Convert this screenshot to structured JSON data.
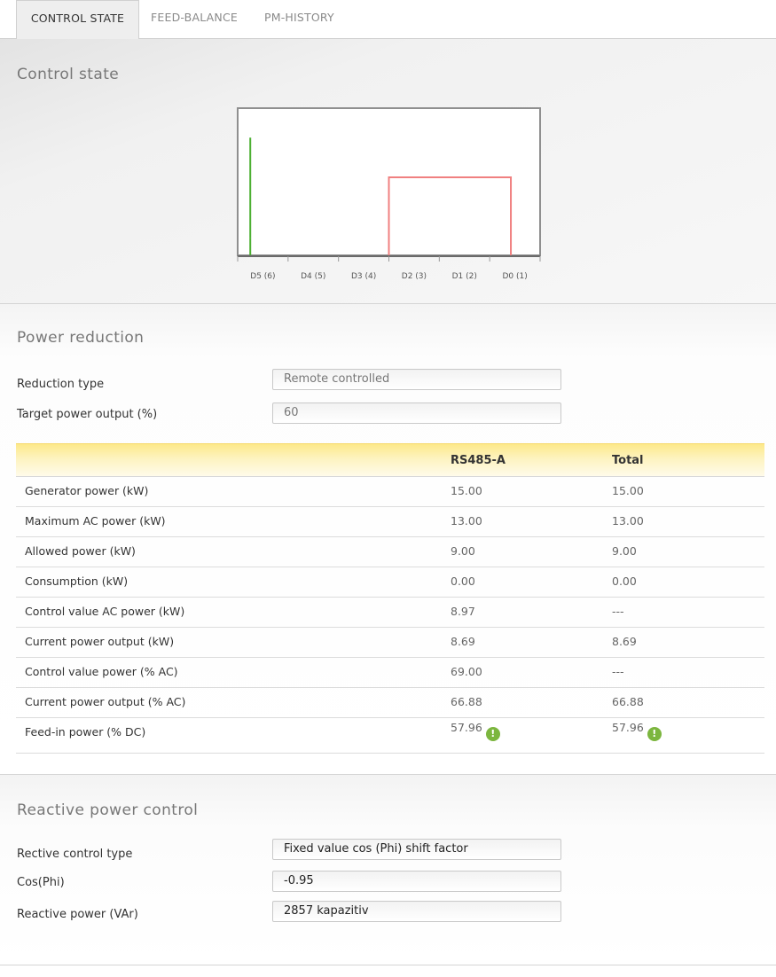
{
  "tabs": [
    {
      "label": "CONTROL STATE",
      "active": true
    },
    {
      "label": "FEED-BALANCE",
      "active": false
    },
    {
      "label": "PM-HISTORY",
      "active": false
    }
  ],
  "control_state": {
    "title": "Control state",
    "chart_data": {
      "type": "line",
      "categories": [
        "D5 (6)",
        "D4 (5)",
        "D3 (4)",
        "D2 (3)",
        "D1 (2)",
        "D0 (1)"
      ],
      "series": [
        {
          "color": "#4caf32",
          "segments": [
            {
              "x": 0.25,
              "level_start": 0.12,
              "level_end": 0.8
            }
          ]
        },
        {
          "color": "#f08080",
          "segments": [
            {
              "from": 3.0,
              "to": 5.0,
              "level": 0.53
            }
          ]
        }
      ]
    }
  },
  "power_reduction": {
    "title": "Power reduction",
    "fields": [
      {
        "label": "Reduction type",
        "value": "Remote controlled"
      },
      {
        "label": "Target power output (%)",
        "value": "60"
      }
    ],
    "table": {
      "headers": [
        "",
        "RS485-A",
        "Total"
      ],
      "rows": [
        {
          "label": "Generator power (kW)",
          "a": "15.00",
          "total": "15.00",
          "warn": false
        },
        {
          "label": "Maximum AC power (kW)",
          "a": "13.00",
          "total": "13.00",
          "warn": false
        },
        {
          "label": "Allowed power (kW)",
          "a": "9.00",
          "total": "9.00",
          "warn": false
        },
        {
          "label": "Consumption (kW)",
          "a": "0.00",
          "total": "0.00",
          "warn": false
        },
        {
          "label": "Control value AC power (kW)",
          "a": "8.97",
          "total": "---",
          "warn": false
        },
        {
          "label": "Current power output (kW)",
          "a": "8.69",
          "total": "8.69",
          "warn": false
        },
        {
          "label": "Control value power (% AC)",
          "a": "69.00",
          "total": "---",
          "warn": false
        },
        {
          "label": "Current power output (% AC)",
          "a": "66.88",
          "total": "66.88",
          "warn": false
        },
        {
          "label": "Feed-in power (% DC)",
          "a": "57.96",
          "total": "57.96",
          "warn": true
        }
      ],
      "warn_icon": "warning-icon",
      "warn_glyph": "!"
    }
  },
  "reactive_power": {
    "title": "Reactive power control",
    "fields": [
      {
        "label": "Rective control type",
        "value": "Fixed value cos (Phi) shift factor"
      },
      {
        "label": "Cos(Phi)",
        "value": "-0.95"
      },
      {
        "label": "Reactive power (VAr)",
        "value": "2857 kapazitiv"
      }
    ]
  },
  "colors": {
    "accent_yellow": "#fde98a",
    "green_signal": "#4caf32",
    "red_signal": "#f08080",
    "warn_green": "#7cb63f"
  }
}
